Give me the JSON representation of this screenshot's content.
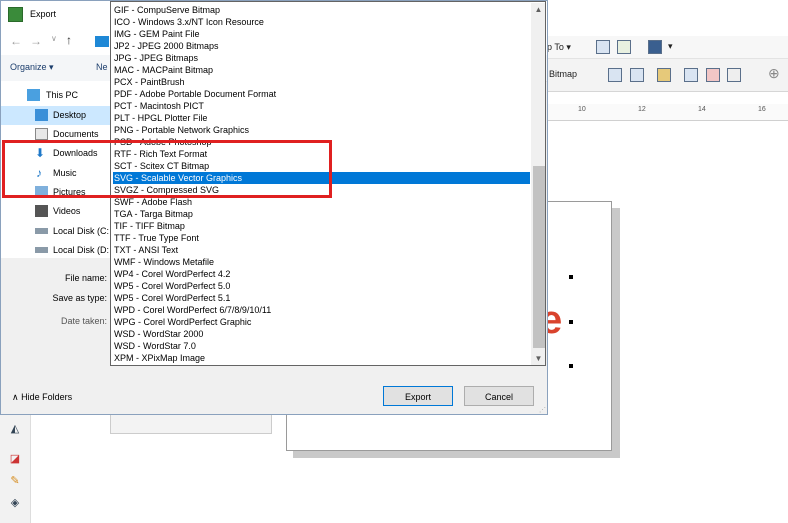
{
  "window": {
    "title": "Export"
  },
  "navigation": {
    "items": [
      {
        "label": "This PC",
        "icon": "monitor-icon",
        "selected": false
      },
      {
        "label": "Desktop",
        "icon": "desktop-folder-icon",
        "selected": true
      },
      {
        "label": "Documents",
        "icon": "documents-icon",
        "selected": false
      },
      {
        "label": "Downloads",
        "icon": "downloads-icon",
        "selected": false
      },
      {
        "label": "Music",
        "icon": "music-icon",
        "selected": false
      },
      {
        "label": "Pictures",
        "icon": "pictures-icon",
        "selected": false
      },
      {
        "label": "Videos",
        "icon": "videos-icon",
        "selected": false
      },
      {
        "label": "Local Disk (C:",
        "icon": "drive-icon",
        "selected": false
      },
      {
        "label": "Local Disk (D:",
        "icon": "drive-icon",
        "selected": false
      }
    ]
  },
  "toolbar": {
    "organize_label": "Organize ▾",
    "new_folder_partial": "Ne"
  },
  "form": {
    "file_name_label": "File name:",
    "save_as_type_label": "Save as type:",
    "date_taken_label": "Date taken:"
  },
  "file_types": [
    "GIF - CompuServe Bitmap",
    "ICO - Windows 3.x/NT Icon Resource",
    "IMG - GEM Paint File",
    "JP2 - JPEG 2000 Bitmaps",
    "JPG - JPEG Bitmaps",
    "MAC - MACPaint Bitmap",
    "PCX - PaintBrush",
    "PDF - Adobe Portable Document Format",
    "PCT - Macintosh PICT",
    "PLT - HPGL Plotter File",
    "PNG - Portable Network Graphics",
    "PSD - Adobe Photoshop",
    "RTF - Rich Text Format",
    "SCT - Scitex CT Bitmap",
    "SVG - Scalable Vector Graphics",
    "SVGZ - Compressed SVG",
    "SWF - Adobe Flash",
    "TGA - Targa Bitmap",
    "TIF - TIFF Bitmap",
    "TTF - True Type Font",
    "TXT - ANSI Text",
    "WMF - Windows Metafile",
    "WP4 - Corel WordPerfect 4.2",
    "WP5 - Corel WordPerfect 5.0",
    "WP5 - Corel WordPerfect 5.1",
    "WPD - Corel WordPerfect 6/7/8/9/10/11",
    "WPG - Corel WordPerfect Graphic",
    "WSD - WordStar 2000",
    "WSD - WordStar 7.0",
    "XPM - XPixMap Image"
  ],
  "selected_file_type": "SVG - Scalable Vector Graphics",
  "buttons": {
    "export": "Export",
    "cancel": "Cancel",
    "hide_folders": "Hide Folders"
  },
  "background_app": {
    "toolbar_export_to_partial": "p To ▾",
    "toolbar_bitmap_partial": "Bitmap",
    "ruler_numbers": [
      "10",
      "12",
      "14",
      "16"
    ]
  },
  "colors": {
    "selection": "#0078d7",
    "highlight_box": "#e02020",
    "nav_selected": "#cce8ff"
  }
}
